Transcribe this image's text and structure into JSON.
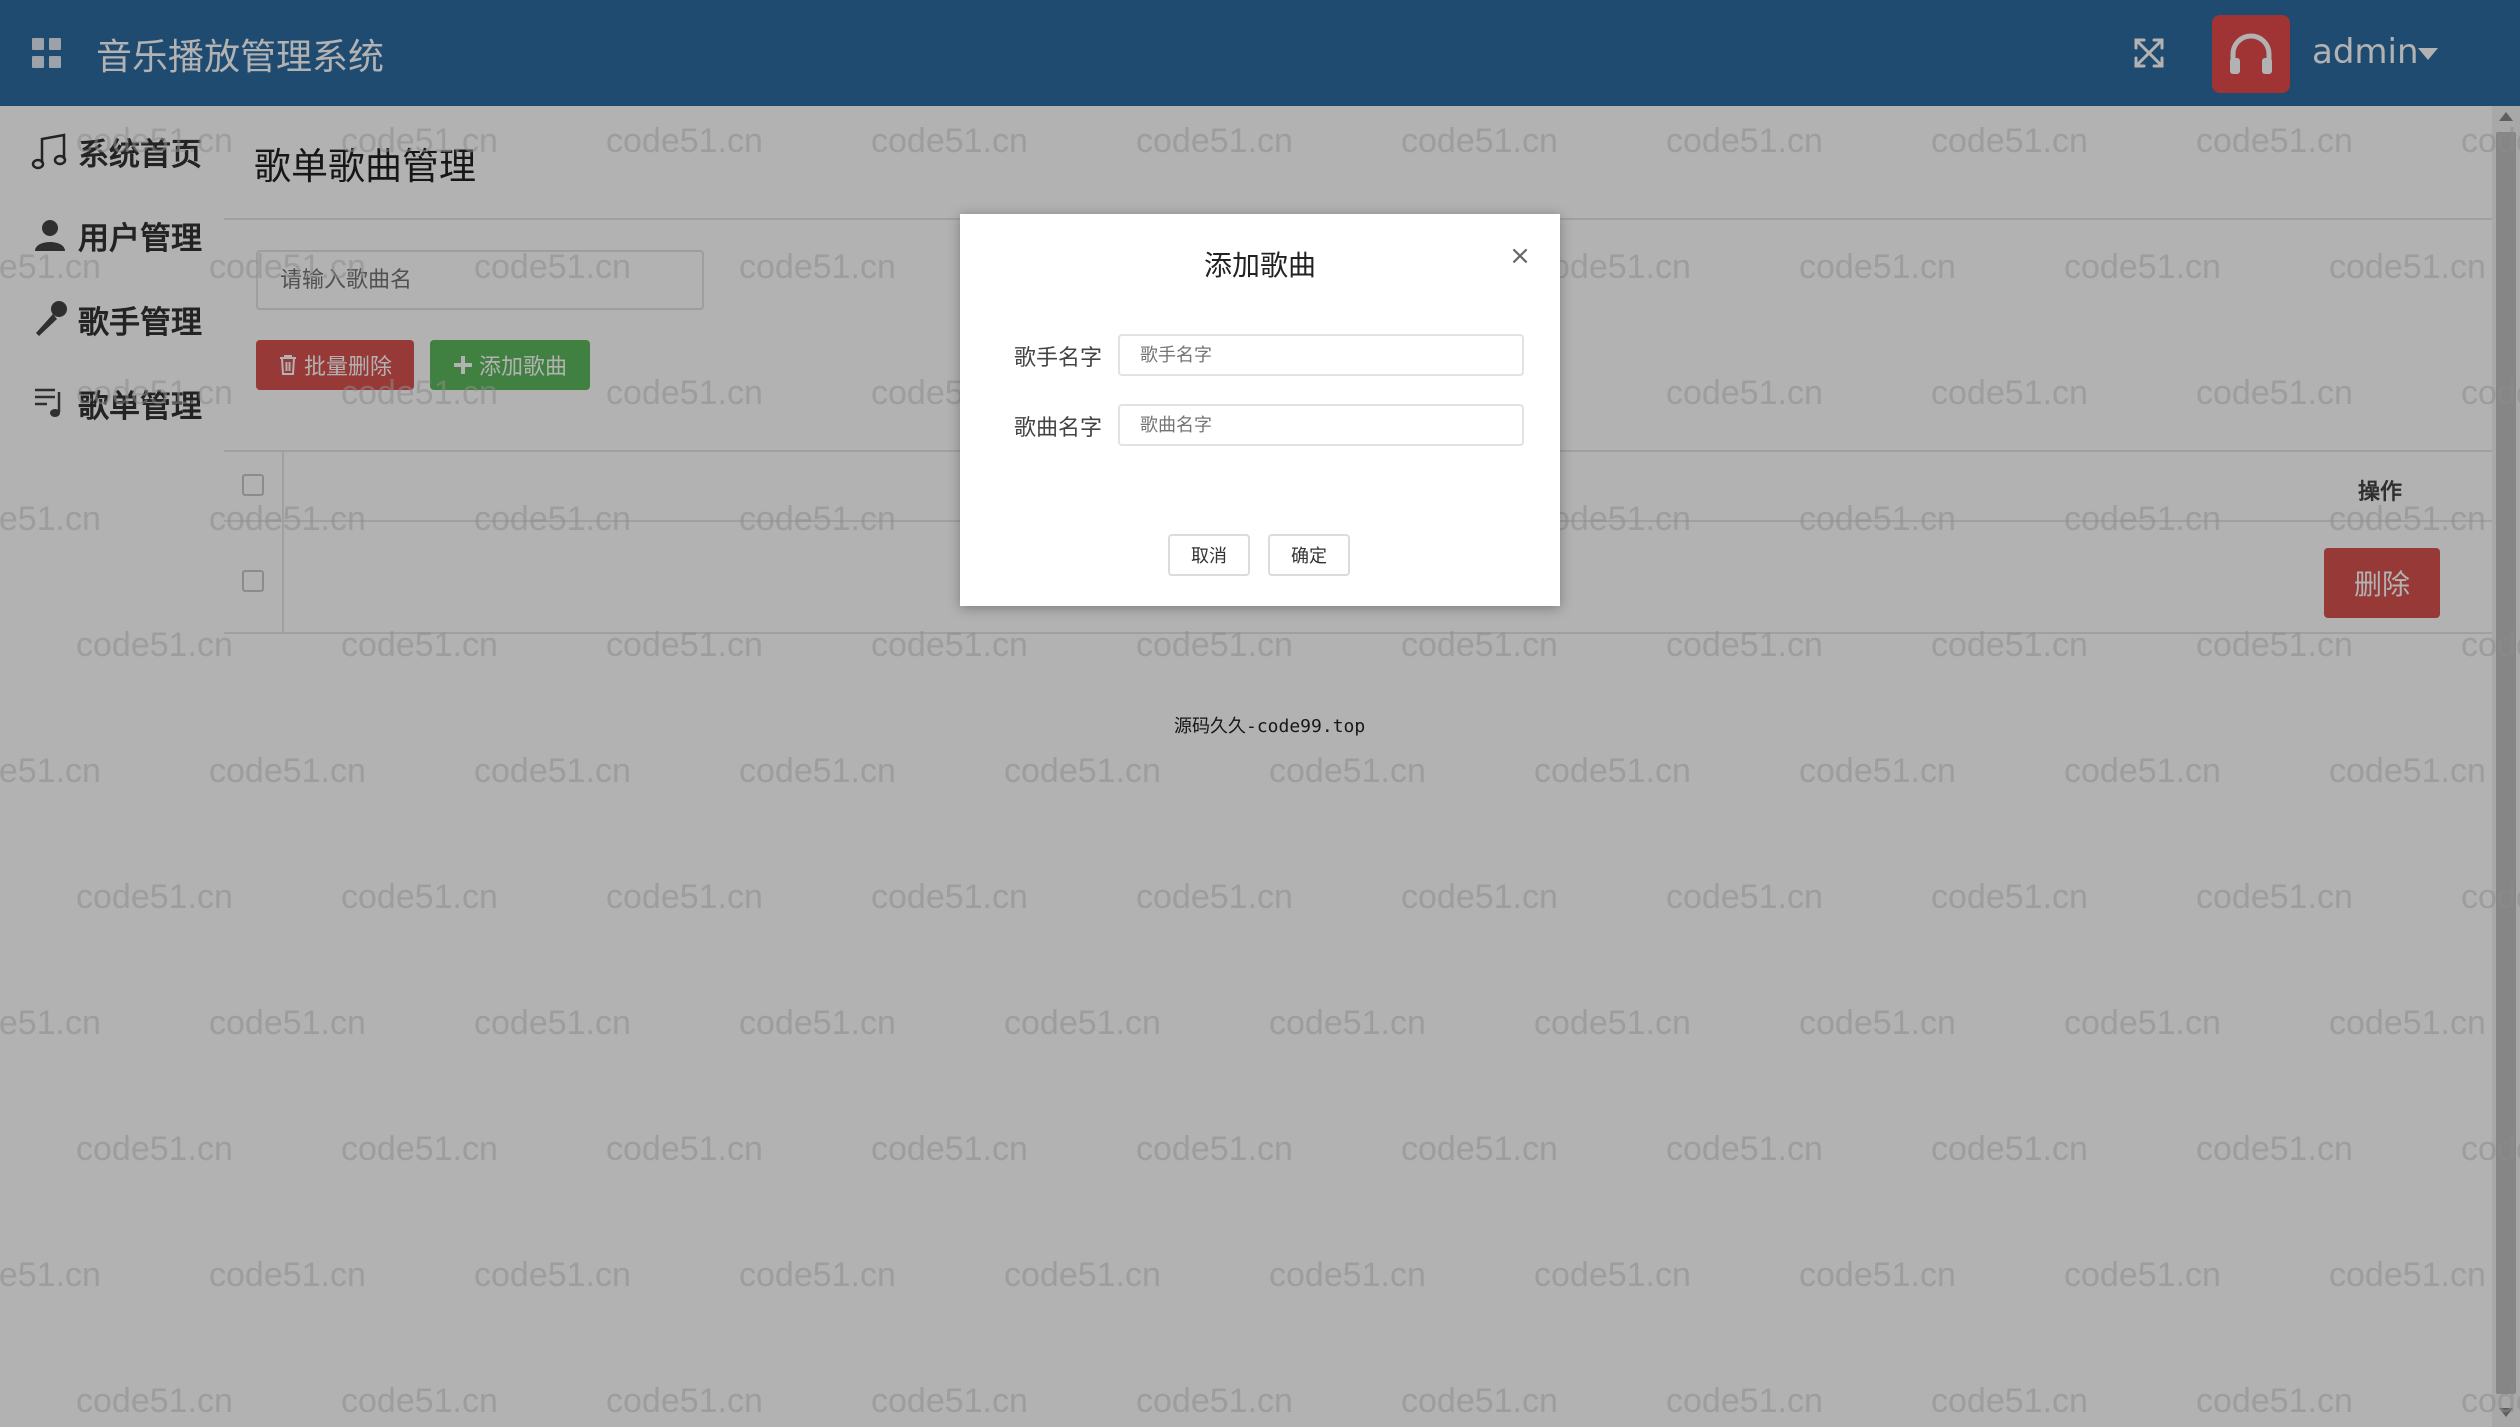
{
  "header": {
    "app_title": "音乐播放管理系统",
    "user_name": "admin"
  },
  "sidebar": {
    "items": [
      {
        "label": "系统首页",
        "icon": "music-note-icon"
      },
      {
        "label": "用户管理",
        "icon": "user-icon"
      },
      {
        "label": "歌手管理",
        "icon": "microphone-icon"
      },
      {
        "label": "歌单管理",
        "icon": "playlist-icon"
      }
    ]
  },
  "main": {
    "page_title": "歌单歌曲管理",
    "search_placeholder": "请输入歌曲名",
    "batch_delete_label": "批量删除",
    "add_song_label": "添加歌曲",
    "table": {
      "header_operation": "操作",
      "row_delete_label": "删除"
    },
    "footer_text": "源码久久-code99.top"
  },
  "modal": {
    "title": "添加歌曲",
    "close_symbol": "×",
    "singer_label": "歌手名字",
    "singer_placeholder": "歌手名字",
    "song_label": "歌曲名字",
    "song_placeholder": "歌曲名字",
    "cancel_label": "取消",
    "confirm_label": "确定"
  },
  "watermark": {
    "text": "code51.cn"
  },
  "colors": {
    "header_bg": "#2d6ca2",
    "danger": "#d9534f",
    "success": "#5cb85c",
    "avatar_bg": "#e64a4a"
  }
}
